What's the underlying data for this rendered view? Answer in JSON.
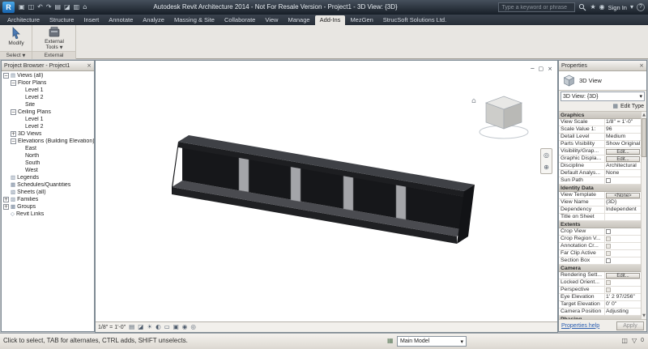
{
  "title_bar": {
    "app_button": "R",
    "title": "Autodesk Revit Architecture 2014 - Not For Resale Version - Project1 - 3D View: {3D}",
    "search_placeholder": "Type a keyword or phrase",
    "sign_in": "Sign In",
    "qat_icons": [
      {
        "name": "open-icon",
        "glyph": "▣"
      },
      {
        "name": "save-icon",
        "glyph": "◫"
      },
      {
        "name": "undo-icon",
        "glyph": "↶"
      },
      {
        "name": "redo-icon",
        "glyph": "↷"
      },
      {
        "name": "print-icon",
        "glyph": "▤"
      },
      {
        "name": "measure-icon",
        "glyph": "◪"
      },
      {
        "name": "tag-icon",
        "glyph": "▥"
      },
      {
        "name": "default-3d-view-icon",
        "glyph": "⌂"
      }
    ]
  },
  "ribbon": {
    "tabs": [
      "Architecture",
      "Structure",
      "Insert",
      "Annotate",
      "Analyze",
      "Massing & Site",
      "Collaborate",
      "View",
      "Manage",
      "Add-Ins",
      "MezGen",
      "StrucSoft Solutions Ltd."
    ],
    "active_tab": "Add-Ins",
    "modify_label": "Modify",
    "select_panel_label": "Select",
    "external_tools_line1": "External",
    "external_tools_line2": "Tools",
    "external_panel_label": "External"
  },
  "project_browser": {
    "title": "Project Browser - Project1",
    "tree": [
      {
        "label": "Views (all)",
        "level": 0,
        "exp": "-",
        "icon": "views"
      },
      {
        "label": "Floor Plans",
        "level": 1,
        "exp": "-"
      },
      {
        "label": "Level 1",
        "level": 2
      },
      {
        "label": "Level 2",
        "level": 2
      },
      {
        "label": "Site",
        "level": 2
      },
      {
        "label": "Ceiling Plans",
        "level": 1,
        "exp": "-"
      },
      {
        "label": "Level 1",
        "level": 2
      },
      {
        "label": "Level 2",
        "level": 2
      },
      {
        "label": "3D Views",
        "level": 1,
        "exp": "+"
      },
      {
        "label": "Elevations (Building Elevation)",
        "level": 1,
        "exp": "-"
      },
      {
        "label": "East",
        "level": 2
      },
      {
        "label": "North",
        "level": 2
      },
      {
        "label": "South",
        "level": 2
      },
      {
        "label": "West",
        "level": 2
      },
      {
        "label": "Legends",
        "level": 0,
        "icon": "legends"
      },
      {
        "label": "Schedules/Quantities",
        "level": 0,
        "icon": "schedules"
      },
      {
        "label": "Sheets (all)",
        "level": 0,
        "icon": "sheets"
      },
      {
        "label": "Families",
        "level": 0,
        "exp": "+",
        "icon": "families"
      },
      {
        "label": "Groups",
        "level": 0,
        "exp": "+",
        "icon": "groups"
      },
      {
        "label": "Revit Links",
        "level": 0,
        "icon": "links"
      }
    ]
  },
  "canvas": {
    "description": "3D view of a dark steel I-beam with four gray web stiffener plates",
    "window_controls": [
      "─",
      "▢",
      "×"
    ]
  },
  "view_control_bar": {
    "scale": "1/8\" = 1'-0\"",
    "icons": [
      {
        "name": "detail-level-icon",
        "glyph": "▤"
      },
      {
        "name": "visual-style-icon",
        "glyph": "◪"
      },
      {
        "name": "sun-path-icon",
        "glyph": "☀"
      },
      {
        "name": "shadows-icon",
        "glyph": "◐"
      },
      {
        "name": "crop-view-icon",
        "glyph": "▭"
      },
      {
        "name": "show-crop-icon",
        "glyph": "▣"
      },
      {
        "name": "temporary-hide-icon",
        "glyph": "◉"
      },
      {
        "name": "reveal-hidden-icon",
        "glyph": "◎"
      }
    ]
  },
  "properties": {
    "title": "Properties",
    "type_label": "3D View",
    "type_selector": "3D View: {3D}",
    "edit_type_label": "Edit Type",
    "help_link": "Properties help",
    "apply_label": "Apply",
    "rows": [
      {
        "t": "sec",
        "label": "Graphics"
      },
      {
        "t": "row",
        "label": "View Scale",
        "value": "1/8\" = 1'-0\"",
        "ctl": "text"
      },
      {
        "t": "row",
        "label": "Scale Value 1:",
        "value": "96",
        "ctl": "text"
      },
      {
        "t": "row",
        "label": "Detail Level",
        "value": "Medium",
        "ctl": "text"
      },
      {
        "t": "row",
        "label": "Parts Visibility",
        "value": "Show Original",
        "ctl": "text"
      },
      {
        "t": "row",
        "label": "Visibility/Grap...",
        "value": "Edit...",
        "ctl": "btn"
      },
      {
        "t": "row",
        "label": "Graphic Displa...",
        "value": "Edit...",
        "ctl": "btn"
      },
      {
        "t": "row",
        "label": "Discipline",
        "value": "Architectural",
        "ctl": "text"
      },
      {
        "t": "row",
        "label": "Default Analys...",
        "value": "None",
        "ctl": "text"
      },
      {
        "t": "row",
        "label": "Sun Path",
        "ctl": "check"
      },
      {
        "t": "sec",
        "label": "Identity Data"
      },
      {
        "t": "row",
        "label": "View Template",
        "value": "<None>",
        "ctl": "btn"
      },
      {
        "t": "row",
        "label": "View Name",
        "value": "{3D}",
        "ctl": "text"
      },
      {
        "t": "row",
        "label": "Dependency",
        "value": "Independent",
        "ctl": "text"
      },
      {
        "t": "row",
        "label": "Title on Sheet",
        "value": "",
        "ctl": "text"
      },
      {
        "t": "sec",
        "label": "Extents"
      },
      {
        "t": "row",
        "label": "Crop View",
        "ctl": "check"
      },
      {
        "t": "row",
        "label": "Crop Region V...",
        "ctl": "check",
        "disabled": true
      },
      {
        "t": "row",
        "label": "Annotation Cr...",
        "ctl": "check",
        "disabled": true
      },
      {
        "t": "row",
        "label": "Far Clip Active",
        "ctl": "check",
        "disabled": true
      },
      {
        "t": "row",
        "label": "Section Box",
        "ctl": "check"
      },
      {
        "t": "sec",
        "label": "Camera"
      },
      {
        "t": "row",
        "label": "Rendering Sett...",
        "value": "Edit...",
        "ctl": "btn"
      },
      {
        "t": "row",
        "label": "Locked Orient...",
        "ctl": "check",
        "disabled": true
      },
      {
        "t": "row",
        "label": "Perspective",
        "ctl": "check",
        "disabled": true
      },
      {
        "t": "row",
        "label": "Eye Elevation",
        "value": "1' 2 97/256\"",
        "ctl": "text"
      },
      {
        "t": "row",
        "label": "Target Elevation",
        "value": "0' 0\"",
        "ctl": "text"
      },
      {
        "t": "row",
        "label": "Camera Position",
        "value": "Adjusting",
        "ctl": "text"
      },
      {
        "t": "sec",
        "label": "Phasing"
      }
    ]
  },
  "status_bar": {
    "hint": "Click to select, TAB for alternates, CTRL adds, SHIFT unselects.",
    "main_model": "Main Model",
    "filter_count": "0",
    "right_icons": [
      {
        "name": "editable-only-icon",
        "glyph": "◫"
      },
      {
        "name": "filter-icon",
        "glyph": "▽"
      }
    ]
  }
}
